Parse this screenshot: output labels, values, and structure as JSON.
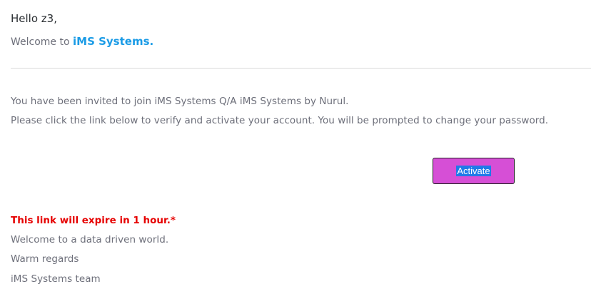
{
  "email": {
    "greeting": "Hello z3,",
    "welcome_prefix": "Welcome to ",
    "brand_name": "iMS Systems.",
    "invite_text": "You have been invited to join iMS Systems Q/A iMS Systems by Nurul.",
    "instruction_text": "Please click the link below to verify and activate your account. You will be prompted to change your password.",
    "activate_label": "Activate",
    "expire_notice": "This link will expire in 1 hour.*",
    "tagline": "Welcome to a data driven world.",
    "regards": "Warm regards",
    "signature": "iMS Systems team"
  },
  "colors": {
    "brand": "#1a9be6",
    "button_bg": "#d64fd6",
    "warning": "#e60000",
    "body_text": "#6d6f7a"
  }
}
